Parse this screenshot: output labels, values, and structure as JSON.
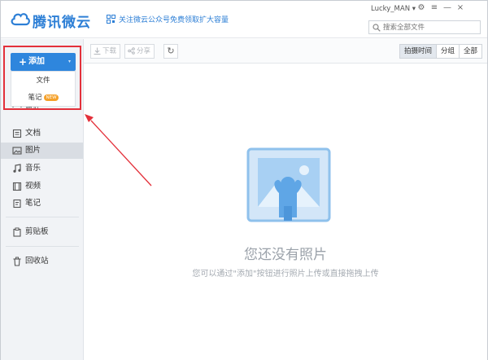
{
  "app": {
    "logo_text": "腾讯微云",
    "promo_text": "关注微云公众号免费领取扩大容量"
  },
  "header": {
    "username": "Lucky_MAN",
    "user_caret": "▾",
    "controls": [
      "⚙",
      "≡",
      "—",
      "×"
    ],
    "search_placeholder": "搜索全部文件"
  },
  "toolbar": {
    "download_label": "下载",
    "share_label": "分享",
    "refresh_glyph": "↻",
    "view_options": [
      "拍摄时间",
      "分组",
      "全部"
    ],
    "active_view": "拍摄时间"
  },
  "sidebar": {
    "add_button": "添加",
    "add_plus": "+",
    "add_caret": "▾",
    "dropdown_items": [
      {
        "label": "文件"
      },
      {
        "label": "笔记",
        "badge": "NEW"
      }
    ],
    "recent_label": "最近",
    "items": [
      {
        "label": "文档",
        "icon": "document-icon"
      },
      {
        "label": "图片",
        "icon": "image-icon",
        "active": true
      },
      {
        "label": "音乐",
        "icon": "music-icon"
      },
      {
        "label": "视频",
        "icon": "video-icon"
      },
      {
        "label": "笔记",
        "icon": "note-icon"
      },
      {
        "label": "剪贴板",
        "icon": "clipboard-icon"
      },
      {
        "label": "回收站",
        "icon": "trash-icon"
      }
    ]
  },
  "empty_state": {
    "title": "您还没有照片",
    "subtitle": "您可以通过\"添加\"按钮进行照片上传或直接拖拽上传"
  },
  "colors": {
    "brand_blue": "#2e86dd",
    "highlight_red": "#e3303a",
    "badge_orange": "#f5a12a"
  }
}
